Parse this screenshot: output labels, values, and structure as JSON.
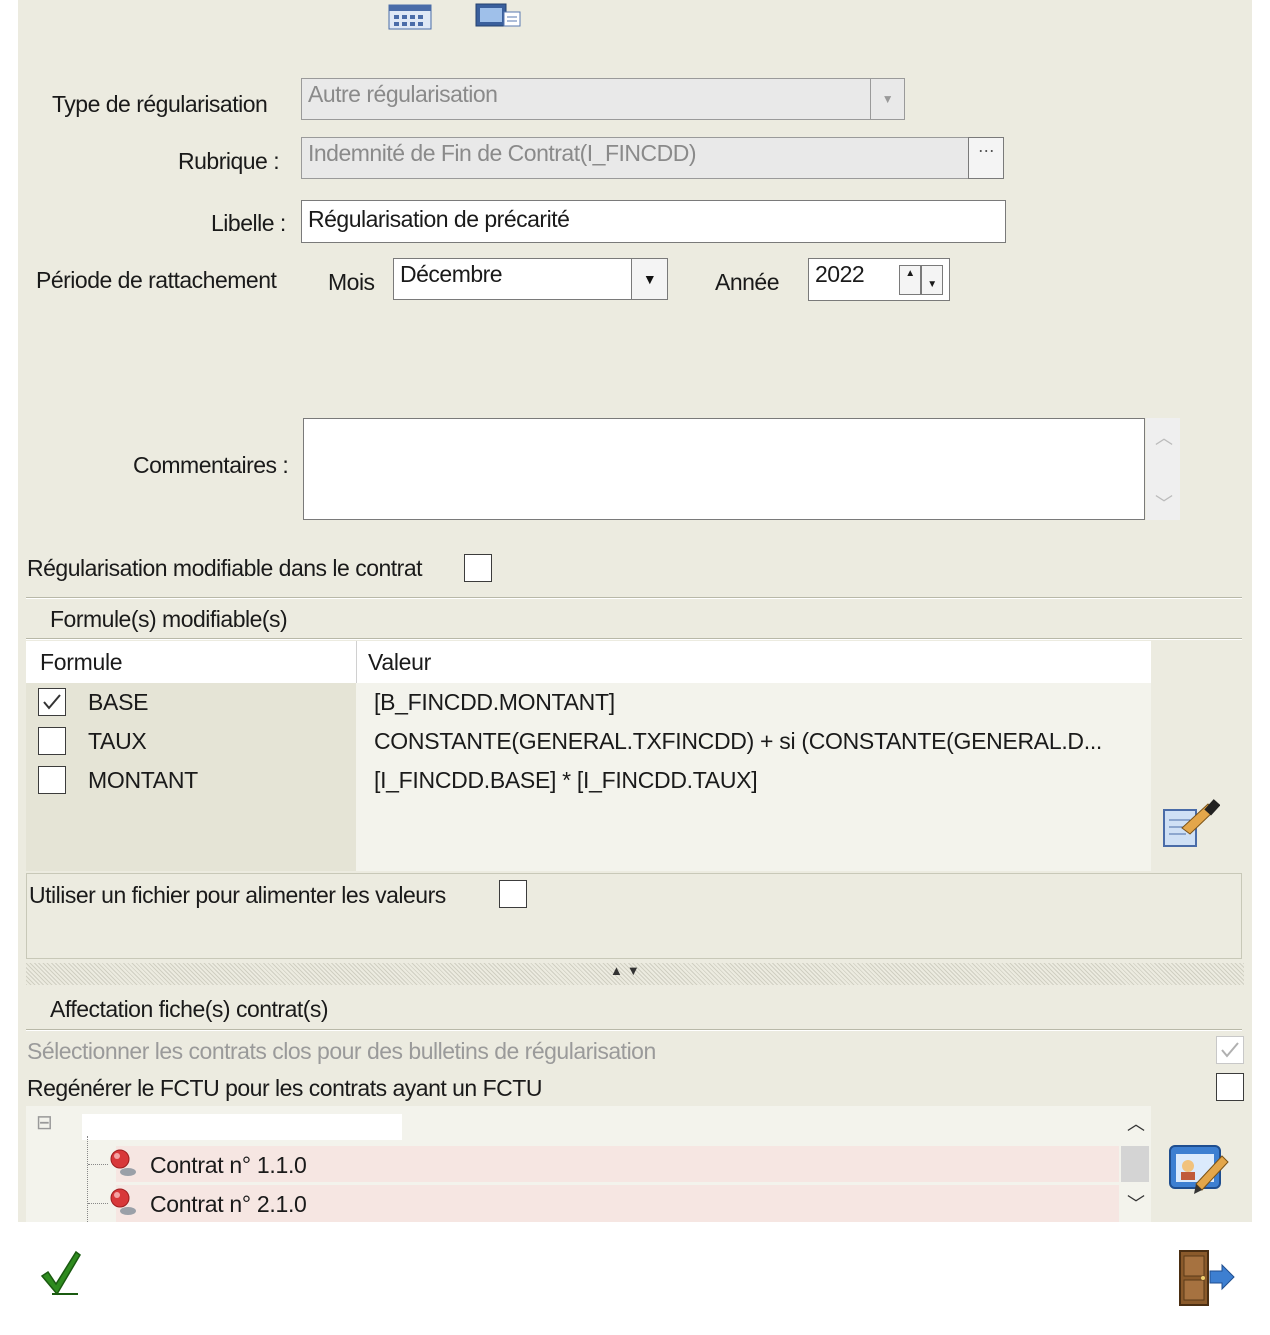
{
  "form": {
    "type_label": "Type de régularisation",
    "type_value": "Autre régularisation",
    "rubrique_label": "Rubrique :",
    "rubrique_value": "Indemnité de Fin de Contrat(I_FINCDD)",
    "rubrique_browse": "···",
    "libelle_label": "Libelle :",
    "libelle_value": "Régularisation de précarité",
    "periode_label": "Période de rattachement",
    "mois_label": "Mois",
    "mois_value": "Décembre",
    "annee_label": "Année",
    "annee_value": "2022",
    "commentaires_label": "Commentaires :",
    "commentaires_value": "",
    "modifiable_label": "Régularisation modifiable dans le contrat",
    "modifiable_checked": false
  },
  "formules": {
    "section_title": "Formule(s) modifiable(s)",
    "col_formule": "Formule",
    "col_valeur": "Valeur",
    "rows": [
      {
        "name": "BASE",
        "value": "[B_FINCDD.MONTANT]",
        "checked": true
      },
      {
        "name": "TAUX",
        "value": "CONSTANTE(GENERAL.TXFINCDD) + si (CONSTANTE(GENERAL.D...",
        "checked": false
      },
      {
        "name": "MONTANT",
        "value": "[I_FINCDD.BASE] * [I_FINCDD.TAUX]",
        "checked": false
      }
    ],
    "fichier_label": "Utiliser un fichier pour alimenter les valeurs",
    "fichier_checked": false
  },
  "affectation": {
    "section_title": "Affectation fiche(s) contrat(s)",
    "clos_label": "Sélectionner les contrats clos pour des bulletins de régularisation",
    "clos_checked": true,
    "fctu_label": "Regénérer le FCTU pour les contrats ayant un FCTU",
    "fctu_checked": false,
    "tree_collapse_symbol": "⊟",
    "contracts": [
      "Contrat n° 1.1.0",
      "Contrat n° 2.1.0"
    ]
  },
  "icons": {
    "dropdown": "chevron-down-icon",
    "edit": "edit-formula-icon",
    "assign": "assign-contracts-icon",
    "validate": "checkmark-icon",
    "exit": "exit-door-icon"
  },
  "colors": {
    "panel_bg": "#ecebe0",
    "validate_green": "#2e8b1e",
    "contract_row_bg": "#f6e6e2"
  }
}
